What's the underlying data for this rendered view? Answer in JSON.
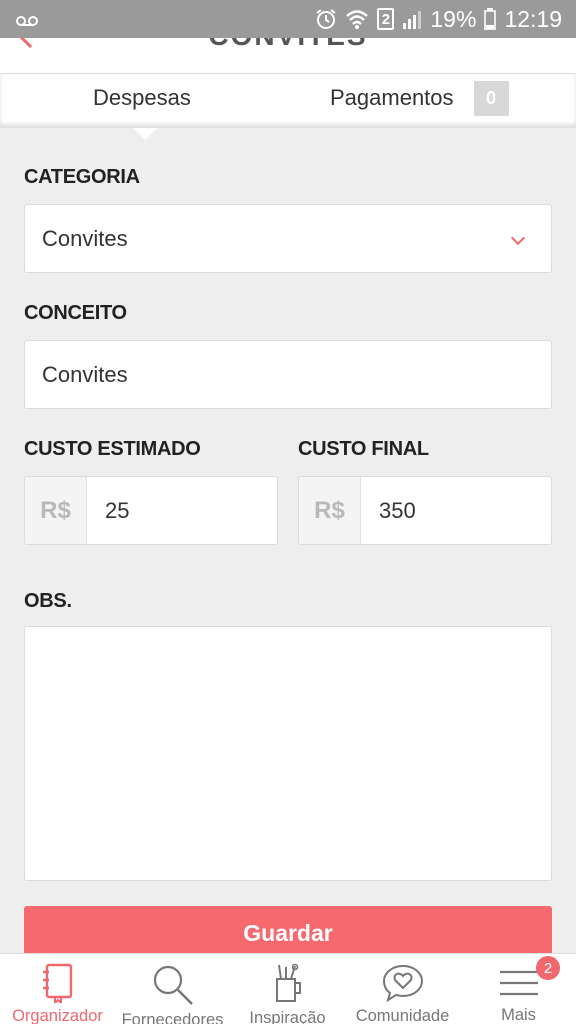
{
  "status_bar": {
    "battery": "19%",
    "time": "12:19",
    "sim": "2"
  },
  "toolbar": {
    "title": "CONVITES"
  },
  "tabs": [
    {
      "label": "Despesas"
    },
    {
      "label": "Pagamentos",
      "badge": "0"
    }
  ],
  "form": {
    "categoria": {
      "label": "CATEGORIA",
      "value": "Convites"
    },
    "conceito": {
      "label": "CONCEITO",
      "value": "Convites"
    },
    "custo_estimado": {
      "label": "CUSTO ESTIMADO",
      "currency": "R$",
      "value": "25"
    },
    "custo_final": {
      "label": "CUSTO FINAL",
      "currency": "R$",
      "value": "350"
    },
    "obs": {
      "label": "OBS.",
      "value": ""
    },
    "save_label": "Guardar"
  },
  "bottom_nav": {
    "items": [
      {
        "label": "Organizador",
        "icon": "notebook-icon",
        "active": true
      },
      {
        "label": "Fornecedores",
        "icon": "search-icon"
      },
      {
        "label": "Inspiração",
        "icon": "cup-icon"
      },
      {
        "label": "Comunidade",
        "icon": "chat-heart-icon"
      },
      {
        "label": "Mais",
        "icon": "menu-icon",
        "badge": "2"
      }
    ]
  },
  "colors": {
    "accent": "#f0676d",
    "status_bar": "#9a9a9a",
    "background": "#eeeeee"
  }
}
